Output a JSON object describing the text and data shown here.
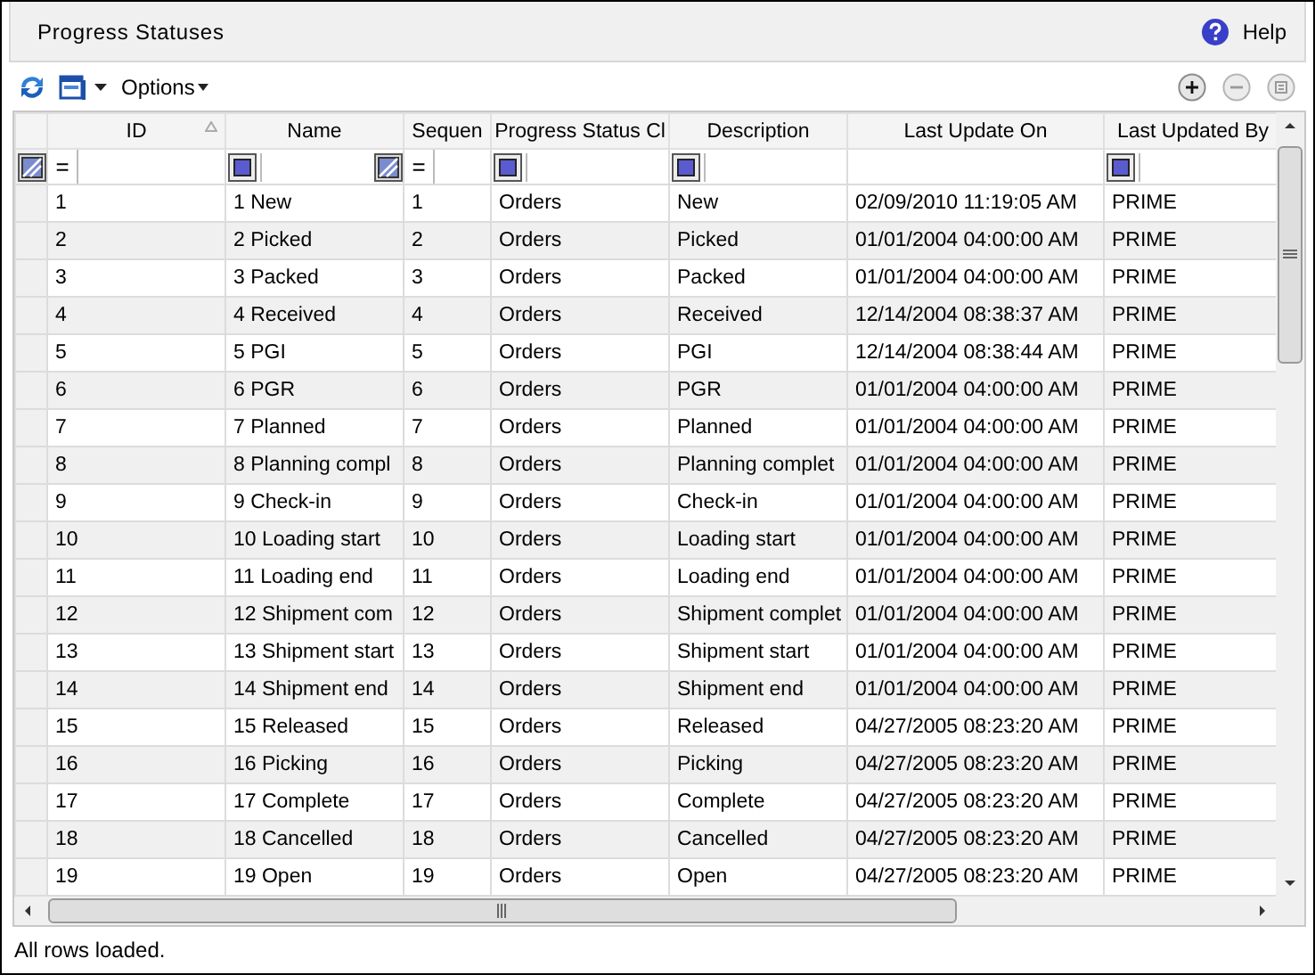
{
  "window": {
    "title": "Progress Statuses",
    "help": "Help"
  },
  "toolbar": {
    "options": "Options"
  },
  "table": {
    "columns": [
      {
        "label": "ID",
        "sorted": true
      },
      {
        "label": "Name",
        "sorted": false
      },
      {
        "label": "Sequen",
        "sorted": false
      },
      {
        "label": "Progress Status Cl",
        "sorted": false
      },
      {
        "label": "Description",
        "sorted": false
      },
      {
        "label": "Last Update On",
        "sorted": false
      },
      {
        "label": "Last Updated By",
        "sorted": false
      }
    ],
    "filters": [
      {
        "kind": "operator",
        "op": "=",
        "menu": false
      },
      {
        "kind": "toggle",
        "menu": true
      },
      {
        "kind": "operator",
        "op": "=",
        "menu": false
      },
      {
        "kind": "toggle",
        "menu": false
      },
      {
        "kind": "toggle",
        "menu": false
      },
      {
        "kind": "blank",
        "menu": false
      },
      {
        "kind": "toggle",
        "menu": false
      }
    ],
    "rows": [
      [
        "1",
        "1 New",
        "1",
        "Orders",
        "New",
        "02/09/2010 11:19:05 AM",
        "PRIME"
      ],
      [
        "2",
        "2 Picked",
        "2",
        "Orders",
        "Picked",
        "01/01/2004 04:00:00 AM",
        "PRIME"
      ],
      [
        "3",
        "3 Packed",
        "3",
        "Orders",
        "Packed",
        "01/01/2004 04:00:00 AM",
        "PRIME"
      ],
      [
        "4",
        "4 Received",
        "4",
        "Orders",
        "Received",
        "12/14/2004 08:38:37 AM",
        "PRIME"
      ],
      [
        "5",
        "5 PGI",
        "5",
        "Orders",
        "PGI",
        "12/14/2004 08:38:44 AM",
        "PRIME"
      ],
      [
        "6",
        "6 PGR",
        "6",
        "Orders",
        "PGR",
        "01/01/2004 04:00:00 AM",
        "PRIME"
      ],
      [
        "7",
        "7 Planned",
        "7",
        "Orders",
        "Planned",
        "01/01/2004 04:00:00 AM",
        "PRIME"
      ],
      [
        "8",
        "8 Planning compl",
        "8",
        "Orders",
        "Planning complet",
        "01/01/2004 04:00:00 AM",
        "PRIME"
      ],
      [
        "9",
        "9 Check-in",
        "9",
        "Orders",
        "Check-in",
        "01/01/2004 04:00:00 AM",
        "PRIME"
      ],
      [
        "10",
        "10 Loading start",
        "10",
        "Orders",
        "Loading start",
        "01/01/2004 04:00:00 AM",
        "PRIME"
      ],
      [
        "11",
        "11 Loading end",
        "11",
        "Orders",
        "Loading end",
        "01/01/2004 04:00:00 AM",
        "PRIME"
      ],
      [
        "12",
        "12 Shipment com",
        "12",
        "Orders",
        "Shipment complet",
        "01/01/2004 04:00:00 AM",
        "PRIME"
      ],
      [
        "13",
        "13 Shipment start",
        "13",
        "Orders",
        "Shipment start",
        "01/01/2004 04:00:00 AM",
        "PRIME"
      ],
      [
        "14",
        "14 Shipment end",
        "14",
        "Orders",
        "Shipment end",
        "01/01/2004 04:00:00 AM",
        "PRIME"
      ],
      [
        "15",
        "15 Released",
        "15",
        "Orders",
        "Released",
        "04/27/2005 08:23:20 AM",
        "PRIME"
      ],
      [
        "16",
        "16 Picking",
        "16",
        "Orders",
        "Picking",
        "04/27/2005 08:23:20 AM",
        "PRIME"
      ],
      [
        "17",
        "17 Complete",
        "17",
        "Orders",
        "Complete",
        "04/27/2005 08:23:20 AM",
        "PRIME"
      ],
      [
        "18",
        "18 Cancelled",
        "18",
        "Orders",
        "Cancelled",
        "04/27/2005 08:23:20 AM",
        "PRIME"
      ],
      [
        "19",
        "19 Open",
        "19",
        "Orders",
        "Open",
        "04/27/2005 08:23:20 AM",
        "PRIME"
      ]
    ]
  },
  "status_bar": "All rows loaded."
}
